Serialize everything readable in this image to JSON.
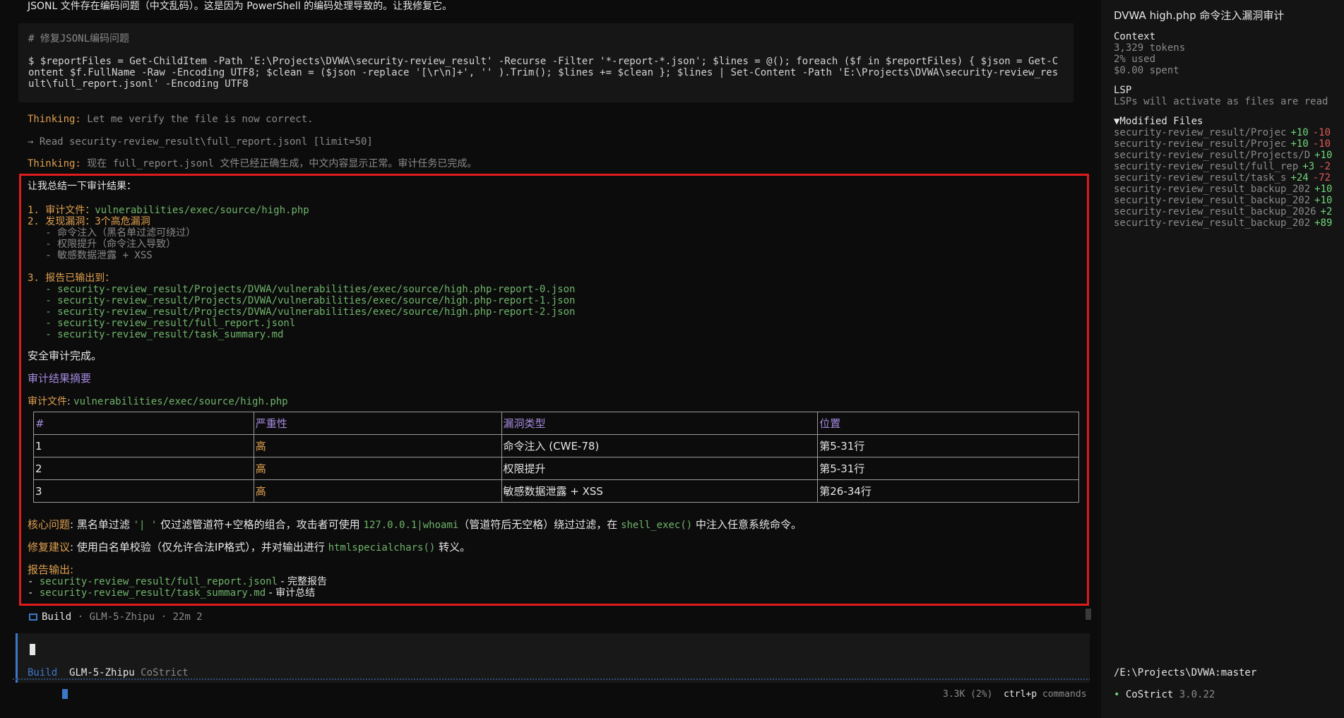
{
  "top_text": "JSONL 文件存在编码问题（中文乱码）。这是因为 PowerShell 的编码处理导致的。让我修复它。",
  "code_block": {
    "title": "# 修复JSONL编码问题",
    "command": "$ $reportFiles = Get-ChildItem -Path 'E:\\Projects\\DVWA\\security-review_result' -Recurse -Filter '*-report-*.json'; $lines = @(); foreach ($f in $reportFiles) { $json = Get-Content $f.FullName -Raw -Encoding UTF8; $clean = ($json -replace '[\\r\\n]+', '' ).Trim(); $lines += $clean }; $lines | Set-Content -Path 'E:\\Projects\\DVWA\\security-review_result\\full_report.jsonl' -Encoding UTF8"
  },
  "thinking1": {
    "label": "Thinking:",
    "text": " Let me verify the file is now correct."
  },
  "read_line": "→ Read security-review_result\\full_report.jsonl [limit=50]",
  "thinking2": {
    "label": "Thinking:",
    "text": " 现在 full_report.jsonl 文件已经正确生成，中文内容显示正常。审计任务已完成。"
  },
  "summary": {
    "intro": "让我总结一下审计结果：",
    "item1_label": "1. 审计文件：",
    "item1_value": "vulnerabilities/exec/source/high.php",
    "item2": "2. 发现漏洞：3个高危漏洞",
    "item2_subs": [
      "   - 命令注入（黑名单过滤可绕过）",
      "   - 权限提升（命令注入导致）",
      "   - 敏感数据泄露 + XSS"
    ],
    "item3": "3. 报告已输出到：",
    "item3_files": [
      "   - security-review_result/Projects/DVWA/vulnerabilities/exec/source/high.php-report-0.json",
      "   - security-review_result/Projects/DVWA/vulnerabilities/exec/source/high.php-report-1.json",
      "   - security-review_result/Projects/DVWA/vulnerabilities/exec/source/high.php-report-2.json",
      "   - security-review_result/full_report.jsonl",
      "   - security-review_result/task_summary.md"
    ],
    "done": "安全审计完成。",
    "heading": "审计结果摘要",
    "file_label": "审计文件",
    "file_value": "vulnerabilities/exec/source/high.php",
    "table": {
      "headers": [
        "#",
        "严重性",
        "漏洞类型",
        "位置"
      ],
      "rows": [
        [
          "1",
          "高",
          "命令注入 (CWE-78)",
          "第5-31行"
        ],
        [
          "2",
          "高",
          "权限提升",
          "第5-31行"
        ],
        [
          "3",
          "高",
          "敏感数据泄露 + XSS",
          "第26-34行"
        ]
      ]
    },
    "core_label": "核心问题",
    "core_text_a": ": 黑名单过滤 ",
    "core_code_a": "'| '",
    "core_text_b": " 仅过滤管道符+空格的组合，攻击者可使用 ",
    "core_code_b": "127.0.0.1|whoami",
    "core_text_c": "（管道符后无空格）绕过过滤，在 ",
    "core_code_c": "shell_exec()",
    "core_text_d": " 中注入任意系统命令。",
    "fix_label": "修复建议",
    "fix_text_a": ": 使用白名单校验（仅允许合法IP格式），并对输出进行 ",
    "fix_code": "htmlspecialchars()",
    "fix_text_b": " 转义。",
    "out_label": "报告输出",
    "out_lines": [
      {
        "prefix": "- ",
        "path": "security-review_result/full_report.jsonl",
        "desc": " - 完整报告"
      },
      {
        "prefix": "- ",
        "path": "security-review_result/task_summary.md",
        "desc": " - 审计总结"
      }
    ]
  },
  "build_status": {
    "mode": "Build",
    "model": "GLM-5-Zhipu",
    "time": "22m 2"
  },
  "input_bar": {
    "mode": "Build",
    "model": "GLM-5-Zhipu",
    "provider": "CoStrict"
  },
  "footer": {
    "tokens": "3.3K (2%)",
    "shortcut": "ctrl+p",
    "shortcut_label": "commands"
  },
  "sidebar": {
    "title": "DVWA high.php 命令注入漏洞审计",
    "context_label": "Context",
    "context_tokens": "3,329 tokens",
    "context_used": "2% used",
    "context_spent": "$0.00 spent",
    "lsp_label": "LSP",
    "lsp_text": "LSPs will activate as files are read",
    "modified_label": "▼Modified Files",
    "files": [
      {
        "name": "security-review_result/Projec",
        "add": "+10",
        "del": "-10"
      },
      {
        "name": "security-review_result/Projec",
        "add": "+10",
        "del": "-10"
      },
      {
        "name": "security-review_result/Projects/D",
        "add": "+10",
        "del": ""
      },
      {
        "name": "security-review_result/full_rep",
        "add": "+3",
        "del": "-2"
      },
      {
        "name": "security-review_result/task_s",
        "add": "+24",
        "del": "-72"
      },
      {
        "name": "security-review_result_backup_202",
        "add": "+10",
        "del": ""
      },
      {
        "name": "security-review_result_backup_202",
        "add": "+10",
        "del": ""
      },
      {
        "name": "security-review_result_backup_2026",
        "add": "+2",
        "del": ""
      },
      {
        "name": "security-review_result_backup_202",
        "add": "+89",
        "del": ""
      }
    ],
    "path": "/E:\\Projects\\DVWA:master",
    "app_dot": "•",
    "app_name": "CoStrict",
    "app_version": "3.0.22"
  },
  "colors": {
    "accent": "#3c78c8",
    "highlight_border": "#e01b1b",
    "orange": "#e0a050",
    "green": "#6fb36a",
    "purple": "#a58be0"
  }
}
